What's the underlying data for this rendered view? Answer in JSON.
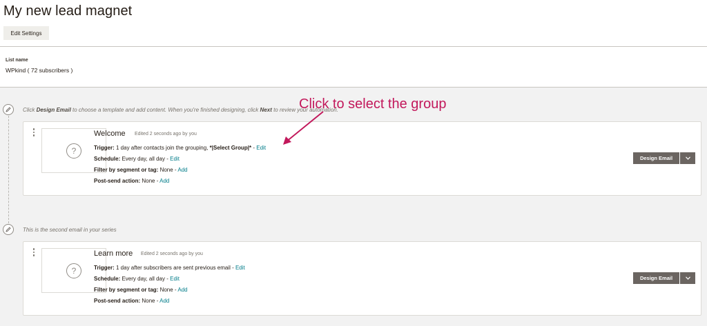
{
  "page": {
    "title": "My new lead magnet",
    "edit_settings_label": "Edit Settings"
  },
  "list": {
    "label": "List name",
    "value": "WPkind ( 72 subscribers )"
  },
  "steps": [
    {
      "note_pre": "Click ",
      "note_bold1": "Design Email",
      "note_mid": " to choose a template and add content. When you're finished designing, click ",
      "note_bold2": "Next",
      "note_post": " to review your automation.",
      "email": {
        "title": "Welcome",
        "edited": "Edited 2 seconds ago by you",
        "trigger_label": "Trigger:",
        "trigger_text": " 1 day after contacts join the grouping, ",
        "trigger_bold": "*|Select Group|*",
        "trigger_sep": " - ",
        "trigger_link": "Edit",
        "schedule_label": "Schedule:",
        "schedule_text": " Every day, all day - ",
        "schedule_link": "Edit",
        "filter_label": "Filter by segment or tag:",
        "filter_text": " None - ",
        "filter_link": "Add",
        "post_label": "Post-send action:",
        "post_text": " None - ",
        "post_link": "Add",
        "design_label": "Design Email"
      }
    },
    {
      "note": "This is the second email in your series",
      "email": {
        "title": "Learn more",
        "edited": "Edited 2 seconds ago by you",
        "trigger_label": "Trigger:",
        "trigger_text": " 1 day after subscribers are sent previous email - ",
        "trigger_link": "Edit",
        "schedule_label": "Schedule:",
        "schedule_text": " Every day, all day - ",
        "schedule_link": "Edit",
        "filter_label": "Filter by segment or tag:",
        "filter_text": " None - ",
        "filter_link": "Add",
        "post_label": "Post-send action:",
        "post_text": " None - ",
        "post_link": "Add",
        "design_label": "Design Email"
      }
    }
  ],
  "annotation": {
    "text": "Click to select the group",
    "color": "#c2185b"
  },
  "icons": {
    "step": "pencil-icon",
    "thumbnail": "question-mark-icon",
    "dropdown": "chevron-down-icon",
    "drag": "drag-handle-icon"
  },
  "colors": {
    "link": "#007c89",
    "button": "#6b6561",
    "background_grey": "#f2f2f2"
  }
}
